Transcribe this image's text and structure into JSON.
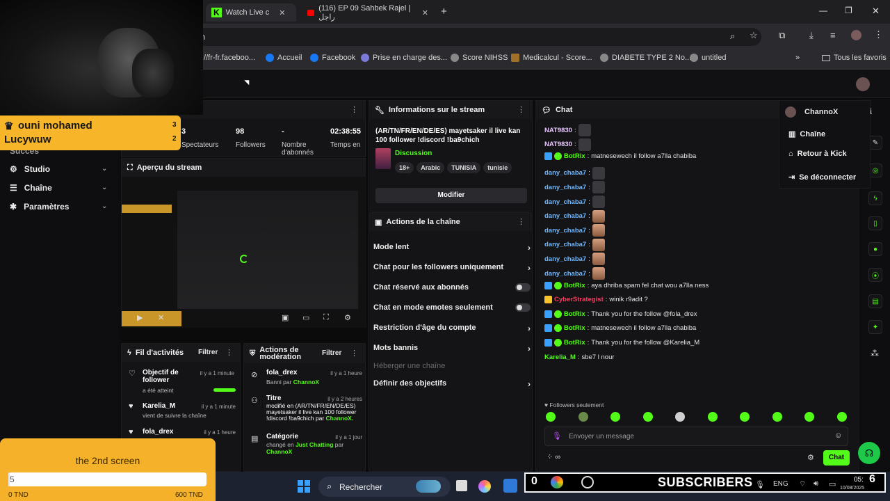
{
  "browser": {
    "tabs": [
      {
        "label": "Watch Live c",
        "active": true
      },
      {
        "label": "(116) EP 09 Sahbek Rajel | راجل",
        "active": false
      }
    ],
    "kick_logo_text": "K",
    "kick_logo_count": "3",
    "url": "m",
    "bookmarks": [
      {
        "label": "://fr-fr.faceboo...",
        "color": "#888"
      },
      {
        "label": "Accueil",
        "color": "#1877f2"
      },
      {
        "label": "Facebook",
        "color": "#1877f2"
      },
      {
        "label": "Prise en charge des...",
        "color": "#7a7ad8"
      },
      {
        "label": "Score NIHSS",
        "color": "#888"
      },
      {
        "label": "Medicalcul - Score...",
        "color": "#a0702a"
      },
      {
        "label": "DIABETE TYPE 2 No...",
        "color": "#888"
      },
      {
        "label": "untitled",
        "color": "#888"
      }
    ],
    "all_favorites": "Tous les favoris"
  },
  "sidebar": {
    "partial_item": "Succès",
    "items": [
      {
        "label": "Studio",
        "icon": "studio-icon"
      },
      {
        "label": "Chaîne",
        "icon": "channel-icon"
      },
      {
        "label": "Paramètres",
        "icon": "gear-icon"
      }
    ]
  },
  "stats": {
    "items": [
      {
        "value": "3",
        "label": "Spectateurs"
      },
      {
        "value": "98",
        "label": "Followers"
      },
      {
        "value": "-",
        "label": "Nombre d'abonnés"
      },
      {
        "value": "02:38:55",
        "label": "Temps en"
      }
    ]
  },
  "preview": {
    "title": "Aperçu du stream"
  },
  "activity": {
    "title": "Fil d'activités",
    "filter": "Filtrer",
    "items": [
      {
        "title": "Objectif de follower",
        "sub": "a été atteint",
        "time": "il y a 1 minute"
      },
      {
        "title": "Karelia_M",
        "sub": "vient de suivre la chaîne",
        "time": "il y a 1 minute"
      },
      {
        "title": "fola_drex",
        "sub": "",
        "time": "il y a 1 heure"
      }
    ]
  },
  "moderation": {
    "title": "Actions de modération",
    "filter": "Filtrer",
    "items": [
      {
        "title": "fola_drex",
        "sub": "Banni par",
        "by": "ChannoX",
        "time": "il y a 1 heure"
      },
      {
        "title": "Titre",
        "sub": "modifié en (AR/TN/FR/EN/DE/ES) mayetsaker il live kan 100 follower !discord !ba9chich par",
        "by": "ChannoX.",
        "time": "il y a 2 heures"
      },
      {
        "title": "Catégorie",
        "sub": "changé en",
        "cat": "Just Chatting",
        "par": "par",
        "by": "ChannoX",
        "time": "il y a 1 jour"
      }
    ]
  },
  "stream_info": {
    "title": "Informations sur le stream",
    "stream_title": "(AR/TN/FR/EN/DE/ES) mayetsaker il live kan 100 follower !discord !ba9chich",
    "category": "Discussion",
    "tags": [
      "18+",
      "Arabic",
      "TUNISIA",
      "tunisie"
    ],
    "edit": "Modifier"
  },
  "channel_actions": {
    "title": "Actions de la chaîne",
    "rows": [
      {
        "label": "Mode lent",
        "kind": "arrow"
      },
      {
        "label": "Chat pour les followers uniquement",
        "kind": "arrow"
      },
      {
        "label": "Chat réservé aux abonnés",
        "kind": "toggle"
      },
      {
        "label": "Chat en mode emotes seulement",
        "kind": "toggle"
      },
      {
        "label": "Restriction d'âge du compte",
        "kind": "arrow"
      },
      {
        "label": "Mots bannis",
        "kind": "arrow"
      },
      {
        "label": "Héberger une chaîne",
        "kind": "disabled"
      },
      {
        "label": "Définir des objectifs",
        "kind": "arrow"
      }
    ]
  },
  "chat": {
    "title": "Chat",
    "lines": [
      {
        "user": "NAT9830",
        "color": "#e9c8ff",
        "text": "",
        "emote": "plain",
        "bot": false
      },
      {
        "user": "NAT9830",
        "color": "#e9c8ff",
        "text": "",
        "emote": "plain",
        "bot": false
      },
      {
        "user": "BotRix",
        "color": "#53fc18",
        "text": "matnesewech il follow a7lla chabiba",
        "emote": "",
        "bot": true
      },
      {
        "user": "dany_chaba7",
        "color": "#6fb7ff",
        "text": "",
        "emote": "plain",
        "bot": false
      },
      {
        "user": "dany_chaba7",
        "color": "#6fb7ff",
        "text": "",
        "emote": "plain",
        "bot": false
      },
      {
        "user": "dany_chaba7",
        "color": "#6fb7ff",
        "text": "",
        "emote": "plain",
        "bot": false
      },
      {
        "user": "dany_chaba7",
        "color": "#6fb7ff",
        "text": "",
        "emote": "face",
        "bot": false
      },
      {
        "user": "dany_chaba7",
        "color": "#6fb7ff",
        "text": "",
        "emote": "face",
        "bot": false
      },
      {
        "user": "dany_chaba7",
        "color": "#6fb7ff",
        "text": "",
        "emote": "face",
        "bot": false
      },
      {
        "user": "dany_chaba7",
        "color": "#6fb7ff",
        "text": "",
        "emote": "face",
        "bot": false
      },
      {
        "user": "dany_chaba7",
        "color": "#6fb7ff",
        "text": "",
        "emote": "face",
        "bot": false
      },
      {
        "user": "BotRix",
        "color": "#53fc18",
        "text": "aya dhriba spam fel chat wou a7lla ness",
        "emote": "",
        "bot": true
      },
      {
        "user": "CyberStrategist",
        "color": "#ff3860",
        "text": "winik r9adit ?",
        "emote": "",
        "bot": false
      },
      {
        "user": "BotRix",
        "color": "#53fc18",
        "text": "Thank you for the follow @fola_drex",
        "emote": "",
        "bot": true
      },
      {
        "user": "BotRix",
        "color": "#53fc18",
        "text": "matnesewech il follow a7lla chabiba",
        "emote": "",
        "bot": true
      },
      {
        "user": "BotRix",
        "color": "#53fc18",
        "text": "Thank you for the follow @Karelia_M",
        "emote": "",
        "bot": true
      },
      {
        "user": "Karelia_M",
        "color": "#53fc18",
        "text": "sbe7 l nour",
        "emote": "",
        "bot": false
      }
    ],
    "followers_only": "Followers seulement",
    "placeholder": "Envoyer un message",
    "send": "Chat",
    "infinity": "∞"
  },
  "user_menu": {
    "username": "ChannoX",
    "items": [
      {
        "label": "Chaîne",
        "icon": "channel-icon"
      },
      {
        "label": "Retour à Kick",
        "icon": "home-icon"
      },
      {
        "label": "Se déconnecter",
        "icon": "logout-icon"
      }
    ]
  },
  "overlay": {
    "alert_line1": "ouni mohamed",
    "alert_line1_count": "3",
    "alert_line2": "Lucywuw",
    "alert_line2_count": "2",
    "goal_title": "the 2nd screen",
    "goal_current": "5",
    "goal_min": "0 TND",
    "goal_max": "600 TND",
    "goal_fraction": 0.008,
    "subscribers": "SUBSCRIBERS",
    "sub_count": "6",
    "sub_prefix": "0"
  },
  "taskbar": {
    "search": "Rechercher",
    "lang": "ENG",
    "time": "05:",
    "date": "10/08/2025"
  }
}
